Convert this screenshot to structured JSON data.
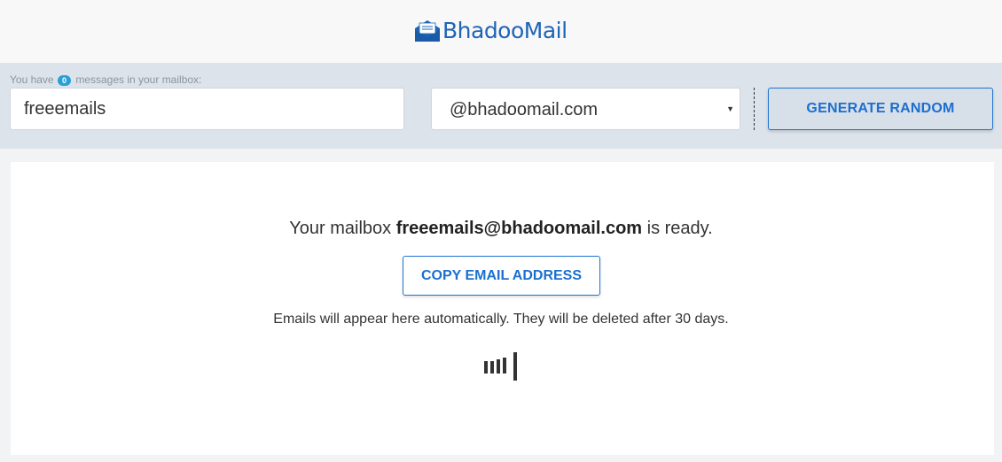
{
  "header": {
    "logo_text": "BhadooMail",
    "logo_icon": "envelope-icon",
    "brand_color": "#1e64b6"
  },
  "toolbar": {
    "info_prefix": "You have",
    "message_count": "0",
    "info_suffix": "messages in your mailbox:",
    "username_value": "freeemails",
    "domain_value": "@bhadoomail.com",
    "generate_label": "GENERATE RANDOM"
  },
  "main": {
    "ready_prefix": "Your mailbox",
    "mailbox_address": "freeemails@bhadoomail.com",
    "ready_suffix": "is ready.",
    "copy_label": "COPY EMAIL ADDRESS",
    "note": "Emails will appear here automatically. They will be deleted after 30 days.",
    "loader_icon": "loading-bars-icon"
  }
}
